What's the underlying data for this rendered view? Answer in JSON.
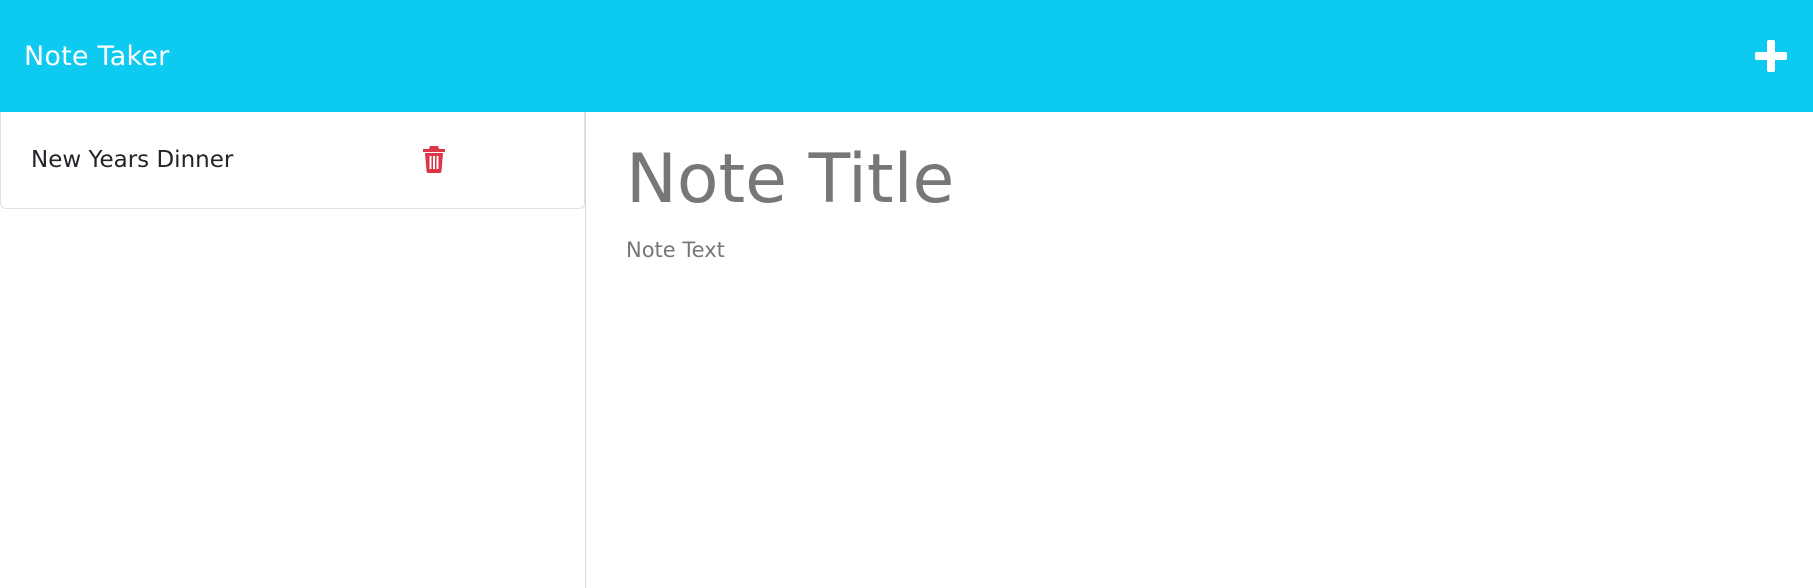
{
  "app": {
    "brand": "Note Taker",
    "accent_color": "#0dcaf0",
    "new_note_icon": "plus-icon"
  },
  "sidebar": {
    "notes": [
      {
        "title": "New Years Dinner",
        "delete_icon": "trash-icon",
        "delete_color": "#dc3545"
      }
    ]
  },
  "editor": {
    "title_placeholder": "Note Title",
    "text_placeholder": "Note Text"
  }
}
